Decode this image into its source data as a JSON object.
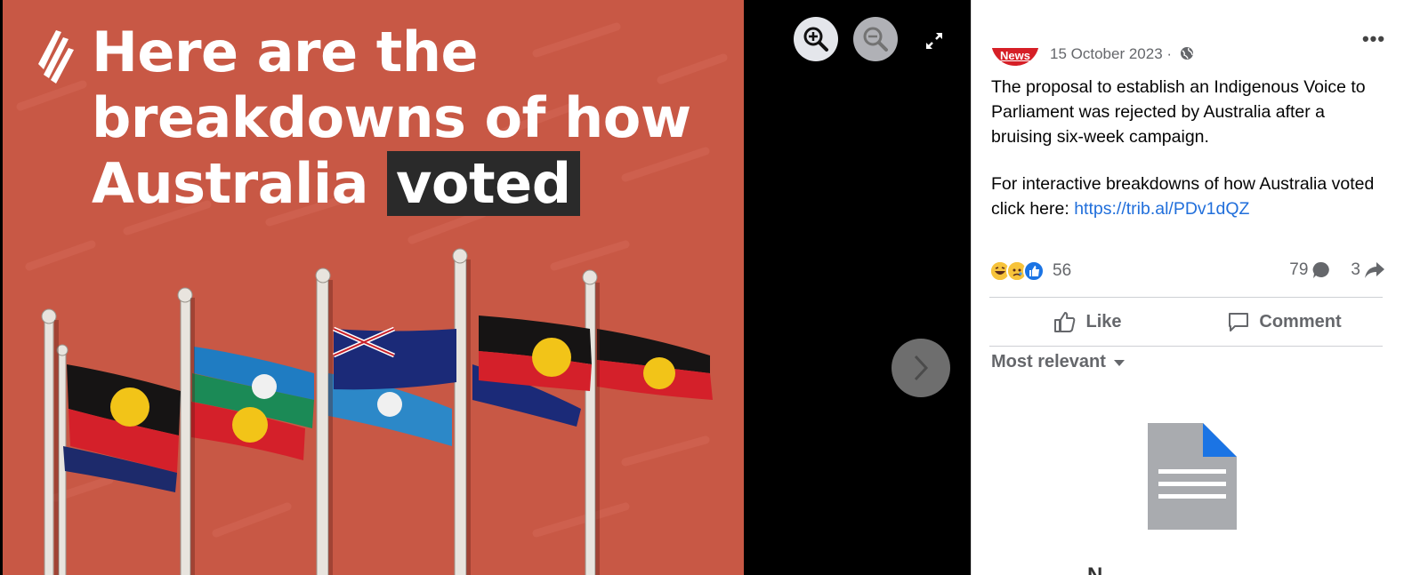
{
  "image": {
    "headline_lines": [
      "Here are the",
      "breakdowns of how",
      "Australia"
    ],
    "headline_highlight": "voted",
    "background_color": "#c85845"
  },
  "viewer_controls": {
    "zoom_in_icon": "zoom-in-icon",
    "zoom_out_icon": "zoom-out-icon",
    "fullscreen_icon": "expand-icon",
    "next_icon": "chevron-right-icon"
  },
  "post": {
    "avatar_text": "News",
    "date": "15 October 2023 ·",
    "audience_icon": "globe-icon",
    "paragraph1": "The proposal to establish an Indigenous Voice to Parliament was rejected by Australia after a bruising six-week campaign.",
    "paragraph2_text": "For interactive breakdowns of how Australia voted click here: ",
    "link": "https://trib.al/PDv1dQZ",
    "reaction_count": "56",
    "comment_count": "79",
    "share_count": "3",
    "like_label": "Like",
    "comment_label": "Comment",
    "sort_label": "Most relevant",
    "empty_text_cut": "N"
  },
  "colors": {
    "accent_blue": "#1b74e4",
    "link_blue": "#216fdb",
    "news_red": "#d61f26"
  }
}
